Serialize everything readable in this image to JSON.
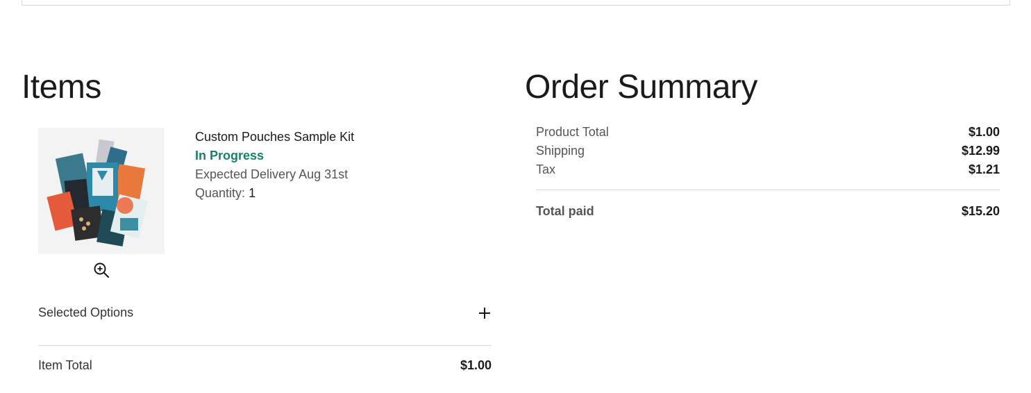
{
  "items_section": {
    "title": "Items",
    "product": {
      "name": "Custom Pouches Sample Kit",
      "status": "In Progress",
      "delivery": "Expected Delivery Aug 31st",
      "quantity_label": "Quantity:",
      "quantity_value": "1",
      "image_icon": "product-sample-kit-photo",
      "zoom_icon": "zoom-in-icon"
    },
    "selected_options_label": "Selected Options",
    "expand_icon": "plus-icon",
    "item_total_label": "Item Total",
    "item_total_value": "$1.00"
  },
  "order_summary": {
    "title": "Order Summary",
    "rows": [
      {
        "label": "Product Total",
        "value": "$1.00"
      },
      {
        "label": "Shipping",
        "value": "$12.99"
      },
      {
        "label": "Tax",
        "value": "$1.21"
      }
    ],
    "total_label": "Total paid",
    "total_value": "$15.20"
  },
  "colors": {
    "status_green": "#19806a",
    "divider": "#d8d8d8"
  }
}
